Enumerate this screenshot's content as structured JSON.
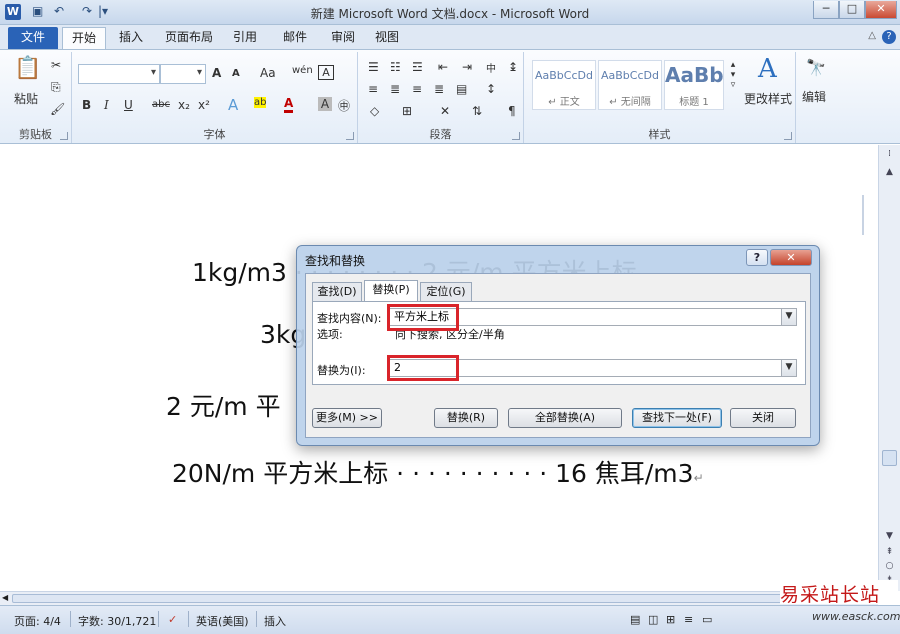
{
  "window": {
    "title": "新建 Microsoft Word 文档.docx - Microsoft Word",
    "app_icon": "W",
    "controls": [
      "─",
      "□",
      "✕"
    ]
  },
  "quick_access": {
    "save_icon": "▣",
    "undo_icon": "↶",
    "redo_icon": "↷",
    "customize_icon": "|▾"
  },
  "tabs": {
    "file": "文件",
    "items": [
      "开始",
      "插入",
      "页面布局",
      "引用",
      "邮件",
      "审阅",
      "视图"
    ],
    "active": "开始",
    "collapse_icon": "△",
    "help_icon": "?"
  },
  "ribbon": {
    "clipboard": {
      "label": "剪贴板",
      "paste": "粘贴",
      "paste_icon": "📋",
      "cut_icon": "✂",
      "copy_icon": "⎘",
      "painter_icon": "🖌"
    },
    "font": {
      "label": "字体",
      "row1": [
        "A",
        "A",
        "Aa",
        "wén",
        "A"
      ],
      "row2": [
        "B",
        "I",
        "U",
        "abc",
        "x₂",
        "x²",
        "A",
        "ab",
        "A",
        "A",
        "㊥"
      ]
    },
    "paragraph": {
      "label": "段落",
      "row1": [
        "☰",
        "☷",
        "☲",
        "⇤",
        "⇥",
        "中",
        "↕",
        "¶"
      ],
      "row2": [
        "≡",
        "≣",
        "≡",
        "≣",
        "▤",
        "↨"
      ],
      "row3": [
        "◇",
        "⊞",
        "✕",
        "⇅"
      ]
    },
    "styles": {
      "label": "样式",
      "items": [
        {
          "sample": "AaBbCcDd",
          "name": "↵ 正文"
        },
        {
          "sample": "AaBbCcDd",
          "name": "↵ 无间隔"
        },
        {
          "sample": "AaBb",
          "name": "标题 1"
        }
      ],
      "change_styles": "更改样式",
      "change_styles_icon": "A"
    },
    "editing": {
      "label": "编辑",
      "icon": "🔭"
    }
  },
  "document": {
    "lines": [
      {
        "text": "1kg/m3 · · · · · · · · 2 元/m 平方米上标",
        "ret": "↵"
      },
      {
        "text": "3kg"
      },
      {
        "text": "2 元/m 平"
      },
      {
        "text": "20N/m 平方米上标 · · · · · · · · · · 16 焦耳/m3",
        "ret": "↵"
      }
    ]
  },
  "dialog": {
    "title": "查找和替换",
    "help_icon": "?",
    "close_icon": "✕",
    "tabs": [
      "查找(D)",
      "替换(P)",
      "定位(G)"
    ],
    "active_tab": "替换(P)",
    "find_label": "查找内容(N):",
    "find_value": "平方米上标",
    "options_label": "选项:",
    "options_value": "向下搜索, 区分全/半角",
    "replace_label": "替换为(I):",
    "replace_value": "2",
    "buttons": {
      "more": "更多(M) >>",
      "replace": "替换(R)",
      "replace_all": "全部替换(A)",
      "find_next": "查找下一处(F)",
      "close": "关闭"
    }
  },
  "statusbar": {
    "page": "页面: 4/4",
    "words": "字数: 30/1,721",
    "proof_icon": "✓",
    "language": "英语(美国)",
    "mode": "插入",
    "view_icons": [
      "▤",
      "◫",
      "⊞",
      "≡",
      "▭"
    ]
  },
  "scrollbar": {
    "up": "▲",
    "down": "▼",
    "prev": "⇞",
    "select": "○",
    "next": "⇟",
    "left": "◀",
    "right": "▶",
    "grip": "⁞"
  },
  "watermark": {
    "text": "易采站长站",
    "url": "www.easck.com"
  }
}
